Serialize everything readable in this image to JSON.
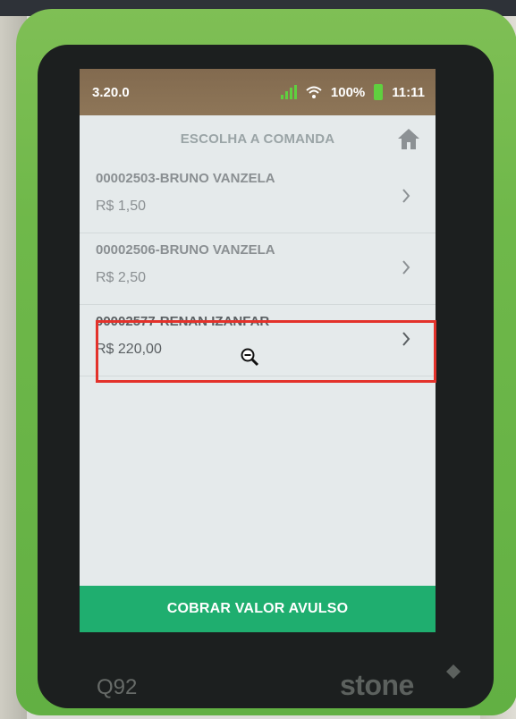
{
  "device": {
    "model": "Q92",
    "brand": "stone"
  },
  "status_bar": {
    "version": "3.20.0",
    "battery": "100%",
    "time": "11:11"
  },
  "header": {
    "title": "ESCOLHA A COMANDA"
  },
  "orders": [
    {
      "title": "00002503-BRUNO VANZELA",
      "amount": "R$ 1,50"
    },
    {
      "title": "00002506-BRUNO VANZELA",
      "amount": "R$ 2,50"
    },
    {
      "title": "00002577-RENAN IZANFAR",
      "amount": "R$ 220,00",
      "selected": true
    }
  ],
  "footer": {
    "action_label": "COBRAR VALOR AVULSO"
  },
  "colors": {
    "device_green": "#6fb84a",
    "status_bar": "#8e7658",
    "screen_bg": "#e5eaeb",
    "action_green": "#1fae6f",
    "highlight_red": "#e3322b"
  },
  "icons": [
    "home-icon",
    "chevron-right-icon",
    "signal-icon",
    "wifi-icon",
    "battery-icon",
    "zoom-out-cursor-icon"
  ]
}
